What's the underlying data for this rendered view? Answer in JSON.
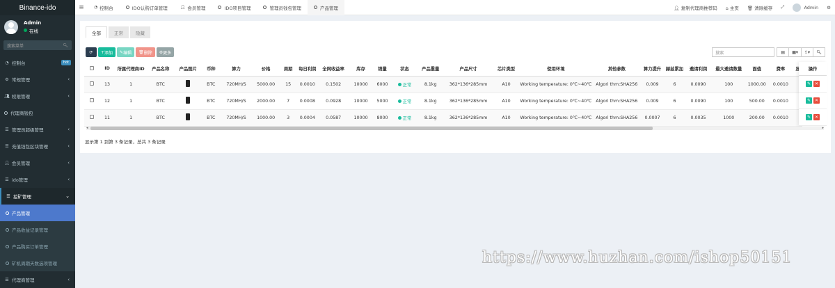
{
  "sidebar": {
    "brand": "Binance-ido",
    "user_name": "Admin",
    "user_status": "在线",
    "search_placeholder": "搜索菜单",
    "hot_badge": "hot",
    "items": [
      {
        "label": "控制台",
        "icon": "dashboard-icon"
      },
      {
        "label": "常规管理",
        "icon": "cogs-icon"
      },
      {
        "label": "权限管理",
        "icon": "group-icon"
      },
      {
        "label": "代理商钱包",
        "icon": "circle-icon"
      },
      {
        "label": "管理员超级管理",
        "icon": "list-icon"
      },
      {
        "label": "充值钱包区块管理",
        "icon": "list-icon"
      },
      {
        "label": "会员管理",
        "icon": "user-icon"
      },
      {
        "label": "ido管理",
        "icon": "list-icon"
      },
      {
        "label": "挖矿管理",
        "icon": "list-icon"
      },
      {
        "label": "产品管理",
        "icon": "circle-icon"
      },
      {
        "label": "产品收益记录管理",
        "icon": "circle-icon"
      },
      {
        "label": "产品购买订单管理",
        "icon": "circle-icon"
      },
      {
        "label": "矿机周期天数选项管理",
        "icon": "circle-icon"
      },
      {
        "label": "代理商管理",
        "icon": "list-icon"
      }
    ]
  },
  "topnav": {
    "tabs": [
      "控制台",
      "IDO认购订单管理",
      "会员管理",
      "IDO项目管理",
      "管理员钱包管理",
      "产品管理"
    ],
    "right": [
      "复制代理商推荐码",
      "主页",
      "清除缓存",
      "Admin"
    ]
  },
  "subtabs": [
    "全部",
    "正常",
    "隐藏"
  ],
  "toolbar": {
    "refresh": "⟳",
    "add": "添加",
    "edit": "编辑",
    "delete": "删除",
    "more": "更多",
    "search_placeholder": "搜索"
  },
  "table": {
    "headers": [
      "ID",
      "所属代理商ID",
      "产品名称",
      "产品图片",
      "币种",
      "算力",
      "价格",
      "周期",
      "每日利润",
      "全网收益率",
      "库存",
      "销量",
      "状态",
      "产品重量",
      "产品尺寸",
      "芯片类型",
      "使用环境",
      "其他参数",
      "算力提升",
      "赫兹累加",
      "邀请利润",
      "最大邀请数量",
      "面值",
      "费率",
      "显"
    ],
    "ops_header": "操作",
    "rows": [
      [
        "13",
        "1",
        "BTC",
        "",
        "BTC",
        "720MH/S",
        "5000.00",
        "15",
        "0.0010",
        "0.1502",
        "10000",
        "6000",
        "正常",
        "8.1kg",
        "362*136*285mm",
        "A10",
        "Working temperature: 0℃~40℃",
        "Algori thm:SHA256",
        "0.009",
        "6",
        "0.0090",
        "100",
        "1000.00",
        "0.0010",
        ""
      ],
      [
        "12",
        "1",
        "BTC",
        "",
        "BTC",
        "720MH/S",
        "2000.00",
        "7",
        "0.0008",
        "0.0928",
        "10000",
        "5000",
        "正常",
        "8.1kg",
        "362*136*285mm",
        "A10",
        "Working temperature: 0℃~40℃",
        "Algori thm:SHA256",
        "0.009",
        "6",
        "0.0090",
        "100",
        "500.00",
        "0.0010",
        ""
      ],
      [
        "11",
        "1",
        "BTC",
        "",
        "BTC",
        "720MH/S",
        "1000.00",
        "3",
        "0.0004",
        "0.0587",
        "10000",
        "8000",
        "正常",
        "8.1kg",
        "362*136*285mm",
        "A10",
        "Working temperature: 0℃~40℃",
        "Algori thm:SHA256",
        "0.0007",
        "6",
        "0.0035",
        "1000",
        "200.00",
        "0.0010",
        ""
      ]
    ]
  },
  "pager_info": "显示第 1 到第 3 条记录，总共 3 条记录",
  "watermark": "https://www.huzhan.com/ishop50151"
}
